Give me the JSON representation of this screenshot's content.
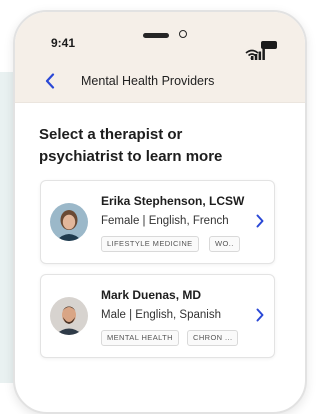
{
  "status_bar": {
    "time": "9:41",
    "icons": [
      "signal-icon",
      "wifi-icon",
      "battery-icon"
    ]
  },
  "nav": {
    "back_icon": "chevron-left-icon",
    "title": "Mental Health Providers"
  },
  "heading": "Select a therapist or psychiatrist to learn more",
  "providers": [
    {
      "name": "Erika Stephenson,  LCSW",
      "details": "Female | English, French",
      "tags": [
        "LIFESTYLE MEDICINE",
        "WO.."
      ]
    },
    {
      "name": "Mark Duenas,  MD",
      "details": "Male | English, Spanish",
      "tags": [
        "MENTAL HEALTH",
        "CHRON ..."
      ]
    }
  ],
  "colors": {
    "accent": "#2a48d6",
    "header_bg": "#f5efe8",
    "side_panel": "#e9f1f1"
  }
}
